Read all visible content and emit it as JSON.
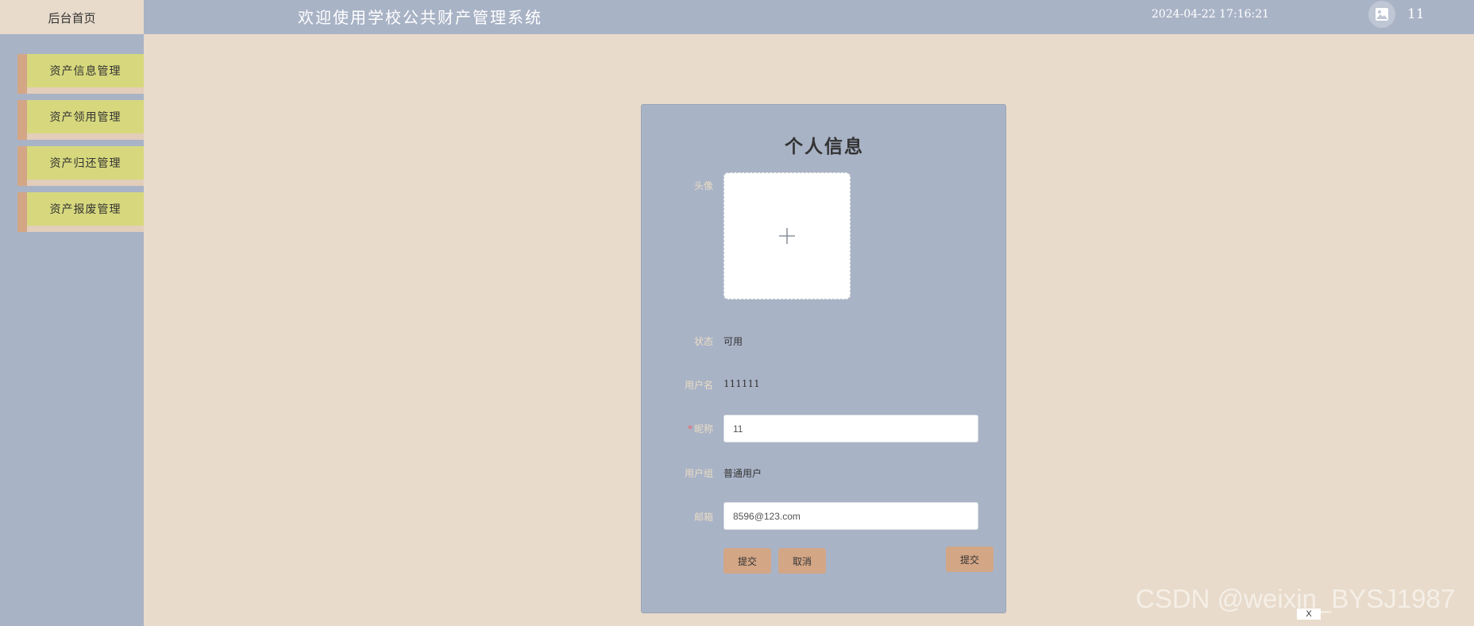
{
  "header": {
    "home_tab": "后台首页",
    "system_title": "欢迎使用学校公共财产管理系统",
    "datetime": "2024-04-22 17:16:21",
    "username": "11"
  },
  "sidebar": {
    "items": [
      {
        "label": "资产信息管理"
      },
      {
        "label": "资产领用管理"
      },
      {
        "label": "资产归还管理"
      },
      {
        "label": "资产报废管理"
      }
    ]
  },
  "profile": {
    "title": "个人信息",
    "avatar_label": "头像",
    "status_label": "状态",
    "status_value": "可用",
    "username_label": "用户名",
    "username_value": "111111",
    "nickname_required_mark": "*",
    "nickname_label": "昵称",
    "nickname_value": "11",
    "group_label": "用户组",
    "group_value": "普通用户",
    "email_label": "邮箱",
    "email_value": "8596@123.com",
    "submit_label": "提交",
    "cancel_label": "取消",
    "extra_label": "提交"
  },
  "watermark": "CSDN @weixin_BYSJ1987",
  "close_badge": "X",
  "colors": {
    "background": "#e8dbcb",
    "bar": "#a9b3c6",
    "menu_face": "#d7d87d",
    "menu_tab": "#d3a686",
    "button": "#d3a686"
  }
}
